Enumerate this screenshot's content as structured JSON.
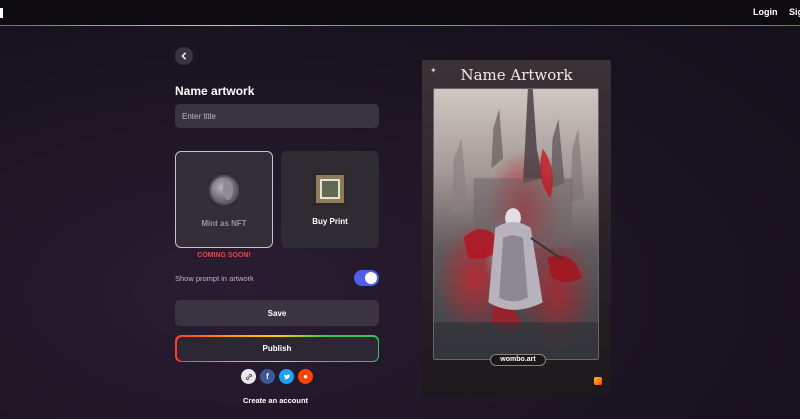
{
  "nav": {
    "login": "Login",
    "signup": "Sig"
  },
  "form": {
    "title": "Name artwork",
    "title_placeholder": "Enter title",
    "options": {
      "nft_label": "Mint as NFT",
      "print_label": "Buy Print"
    },
    "coming_soon": "COMING SOON!",
    "show_prompt_label": "Show prompt in artwork",
    "show_prompt_enabled": true,
    "save_label": "Save",
    "publish_label": "Publish",
    "share": {
      "icons": [
        "link-icon",
        "facebook-icon",
        "twitter-icon",
        "reddit-icon"
      ],
      "facebook_glyph": "f",
      "reddit_glyph": "●"
    },
    "create_account": "Create an account"
  },
  "preview": {
    "title": "Name Artwork",
    "watermark": "wombo.art"
  },
  "colors": {
    "accent": "#4f5ee8",
    "coming_soon": "#e04a4a",
    "facebook": "#3b5998",
    "twitter": "#1da1f2",
    "reddit": "#ff4500"
  }
}
